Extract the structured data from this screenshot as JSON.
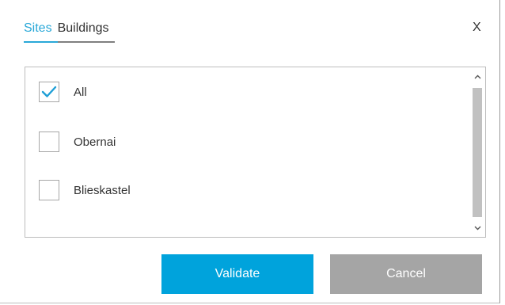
{
  "tabs": [
    {
      "label": "Sites",
      "active": true
    },
    {
      "label": "Buildings",
      "active": false
    }
  ],
  "close_label": "X",
  "items": [
    {
      "label": "All",
      "checked": true
    },
    {
      "label": "Obernai",
      "checked": false
    },
    {
      "label": "Blieskastel",
      "checked": false
    }
  ],
  "buttons": {
    "validate": "Validate",
    "cancel": "Cancel"
  },
  "colors": {
    "accent": "#00a3dc",
    "cancel": "#a5a5a5",
    "active_tab": "#29a8d8",
    "checkmark": "#1f9fd6"
  },
  "icons": {
    "close": "close-icon",
    "check": "checkmark-icon",
    "scroll_up": "chevron-up-icon",
    "scroll_down": "chevron-down-icon"
  }
}
